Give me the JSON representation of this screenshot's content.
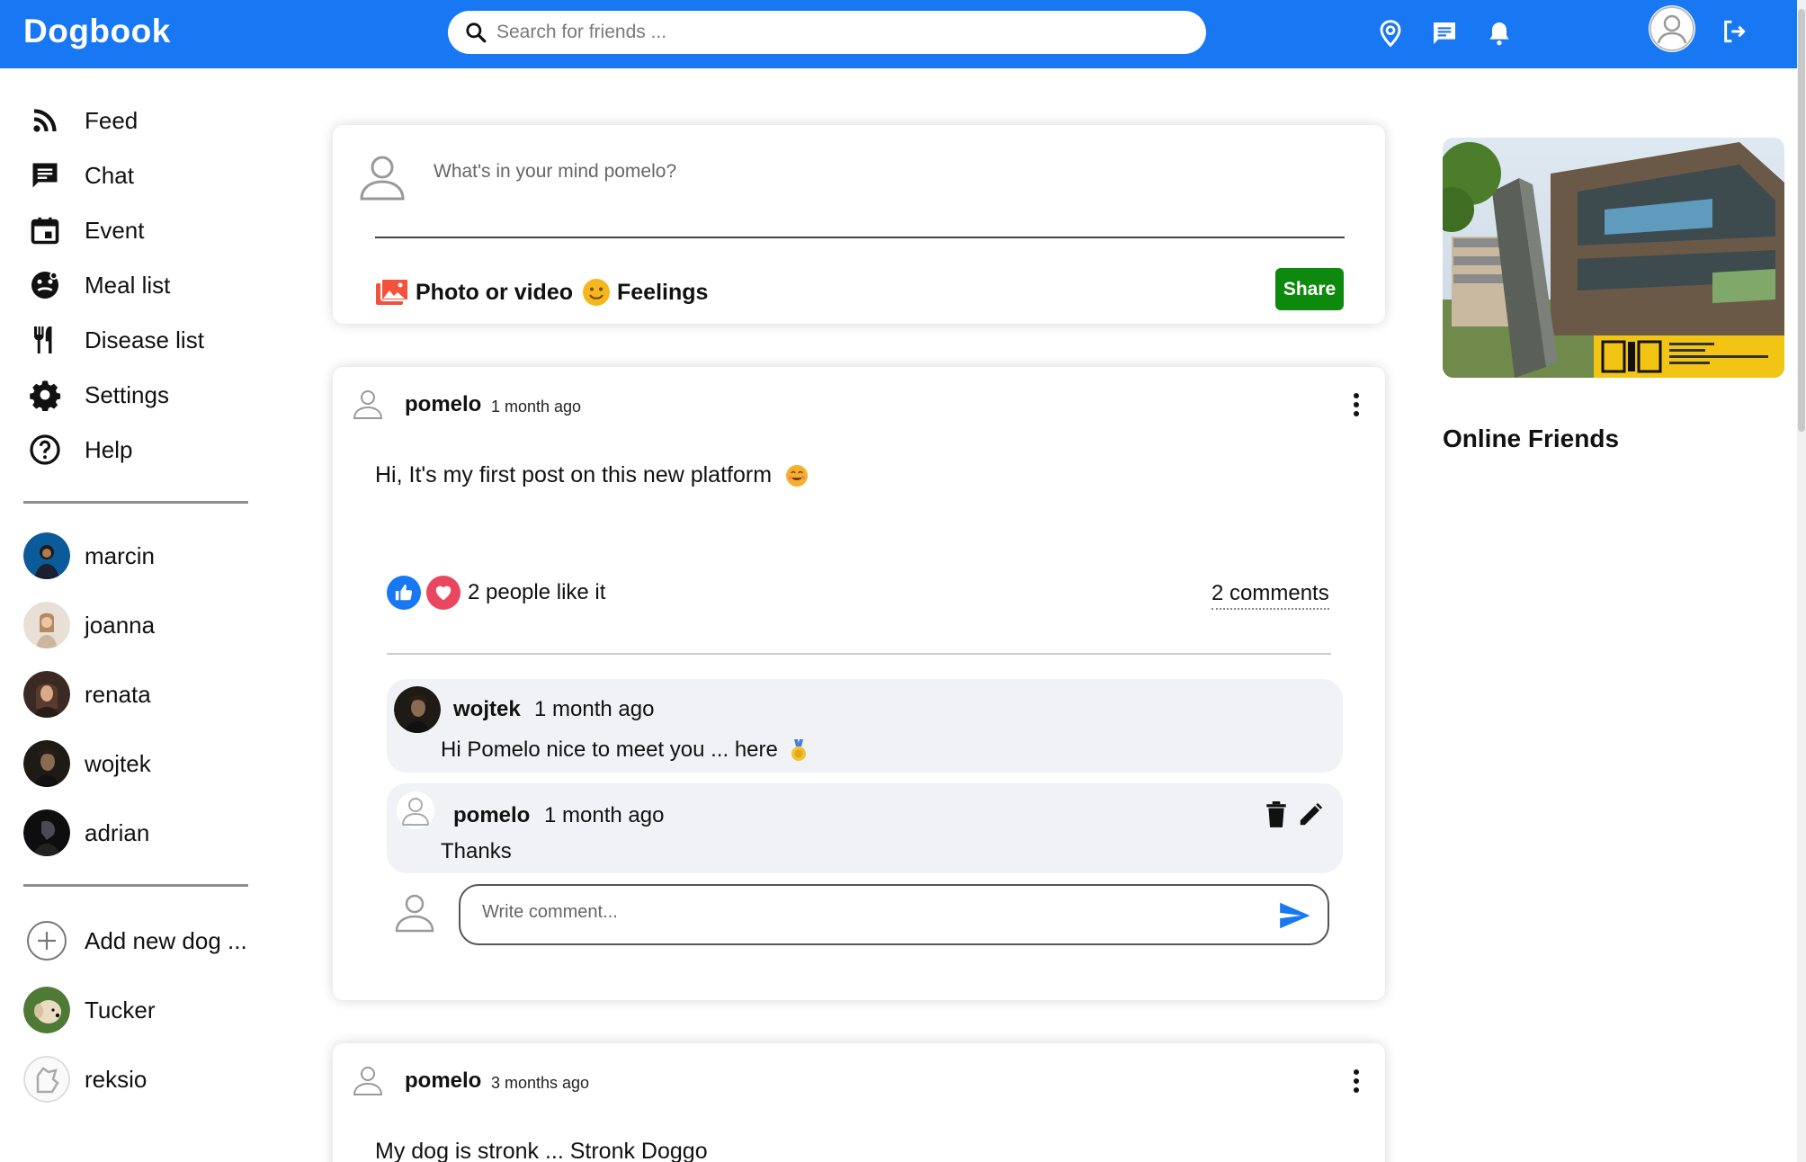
{
  "app": {
    "title": "Dogbook"
  },
  "search": {
    "placeholder": "Search for friends ..."
  },
  "topbar": {
    "icons": [
      "location-icon",
      "chat-icon",
      "bell-icon",
      "avatar",
      "logout-icon"
    ]
  },
  "sidebar": {
    "nav": [
      {
        "label": "Feed",
        "icon": "rss-icon"
      },
      {
        "label": "Chat",
        "icon": "chat-icon"
      },
      {
        "label": "Event",
        "icon": "calendar-icon"
      },
      {
        "label": "Meal list",
        "icon": "meal-icon"
      },
      {
        "label": "Disease list",
        "icon": "fork-knife-icon"
      },
      {
        "label": "Settings",
        "icon": "gear-icon"
      },
      {
        "label": "Help",
        "icon": "help-icon"
      }
    ],
    "friends": [
      {
        "name": "marcin"
      },
      {
        "name": "joanna"
      },
      {
        "name": "renata"
      },
      {
        "name": "wojtek"
      },
      {
        "name": "adrian"
      }
    ],
    "add_dog": "Add new dog ...",
    "dogs": [
      {
        "name": "Tucker"
      },
      {
        "name": "reksio"
      }
    ]
  },
  "share": {
    "placeholder": "What's in your mind pomelo?",
    "photo_label": "Photo or video",
    "feelings_label": "Feelings",
    "share_button": "Share"
  },
  "posts": [
    {
      "user": "pomelo",
      "time": "1 month ago",
      "text": "Hi, It's my first post on this new platform",
      "likes": "2 people like it",
      "comments_count": "2 comments",
      "comments": [
        {
          "user": "wojtek",
          "time": "1 month ago",
          "text": "Hi Pomelo nice to meet you ... here"
        },
        {
          "user": "pomelo",
          "time": "1 month ago",
          "text": "Thanks"
        }
      ],
      "write_placeholder": "Write comment..."
    },
    {
      "user": "pomelo",
      "time": "3 months ago",
      "text": "My dog is stronk ... Stronk Doggo"
    }
  ],
  "right": {
    "banner_caption": "POLITECHNIKA LUBELSKA WYDZIAŁ ELEKTROTECHNIKI I INFORMATYKI",
    "online_title": "Online Friends"
  },
  "colors": {
    "brand": "#1877f2",
    "share": "#0d8a0d",
    "comment_bg": "#f0f2f5",
    "like": "#1877f2",
    "heart": "#e8475f"
  }
}
